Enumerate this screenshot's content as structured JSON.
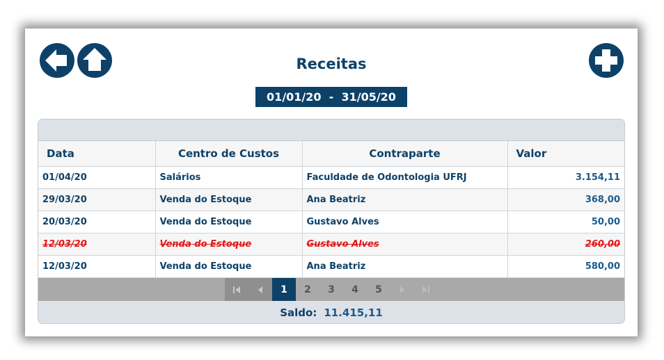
{
  "header": {
    "title": "Receitas",
    "date_range": "01/01/20  -  31/05/20"
  },
  "icons": {
    "back": "arrow-left-icon",
    "home": "home-icon",
    "add": "plus-icon"
  },
  "table": {
    "columns": [
      "Data",
      "Centro de Custos",
      "Contraparte",
      "Valor"
    ],
    "rows": [
      {
        "data": "01/04/20",
        "centro": "Salários",
        "contraparte": "Faculdade de Odontologia UFRJ",
        "valor": "3.154,11",
        "cancelled": false
      },
      {
        "data": "29/03/20",
        "centro": "Venda do Estoque",
        "contraparte": "Ana Beatriz",
        "valor": "368,00",
        "cancelled": false
      },
      {
        "data": "20/03/20",
        "centro": "Venda do Estoque",
        "contraparte": "Gustavo Alves",
        "valor": "50,00",
        "cancelled": false
      },
      {
        "data": "12/03/20",
        "centro": "Venda do Estoque",
        "contraparte": "Gustavo Alves",
        "valor": "260,00",
        "cancelled": true
      },
      {
        "data": "12/03/20",
        "centro": "Venda do Estoque",
        "contraparte": "Ana Beatriz",
        "valor": "580,00",
        "cancelled": false
      }
    ]
  },
  "pager": {
    "pages": [
      "1",
      "2",
      "3",
      "4",
      "5"
    ],
    "current": "1"
  },
  "footer": {
    "saldo_label": "Saldo:",
    "saldo_value": "11.415,11"
  },
  "colors": {
    "primary": "#0d4168",
    "cancelled": "#e01818",
    "pager_bg": "#a9a9a9"
  }
}
